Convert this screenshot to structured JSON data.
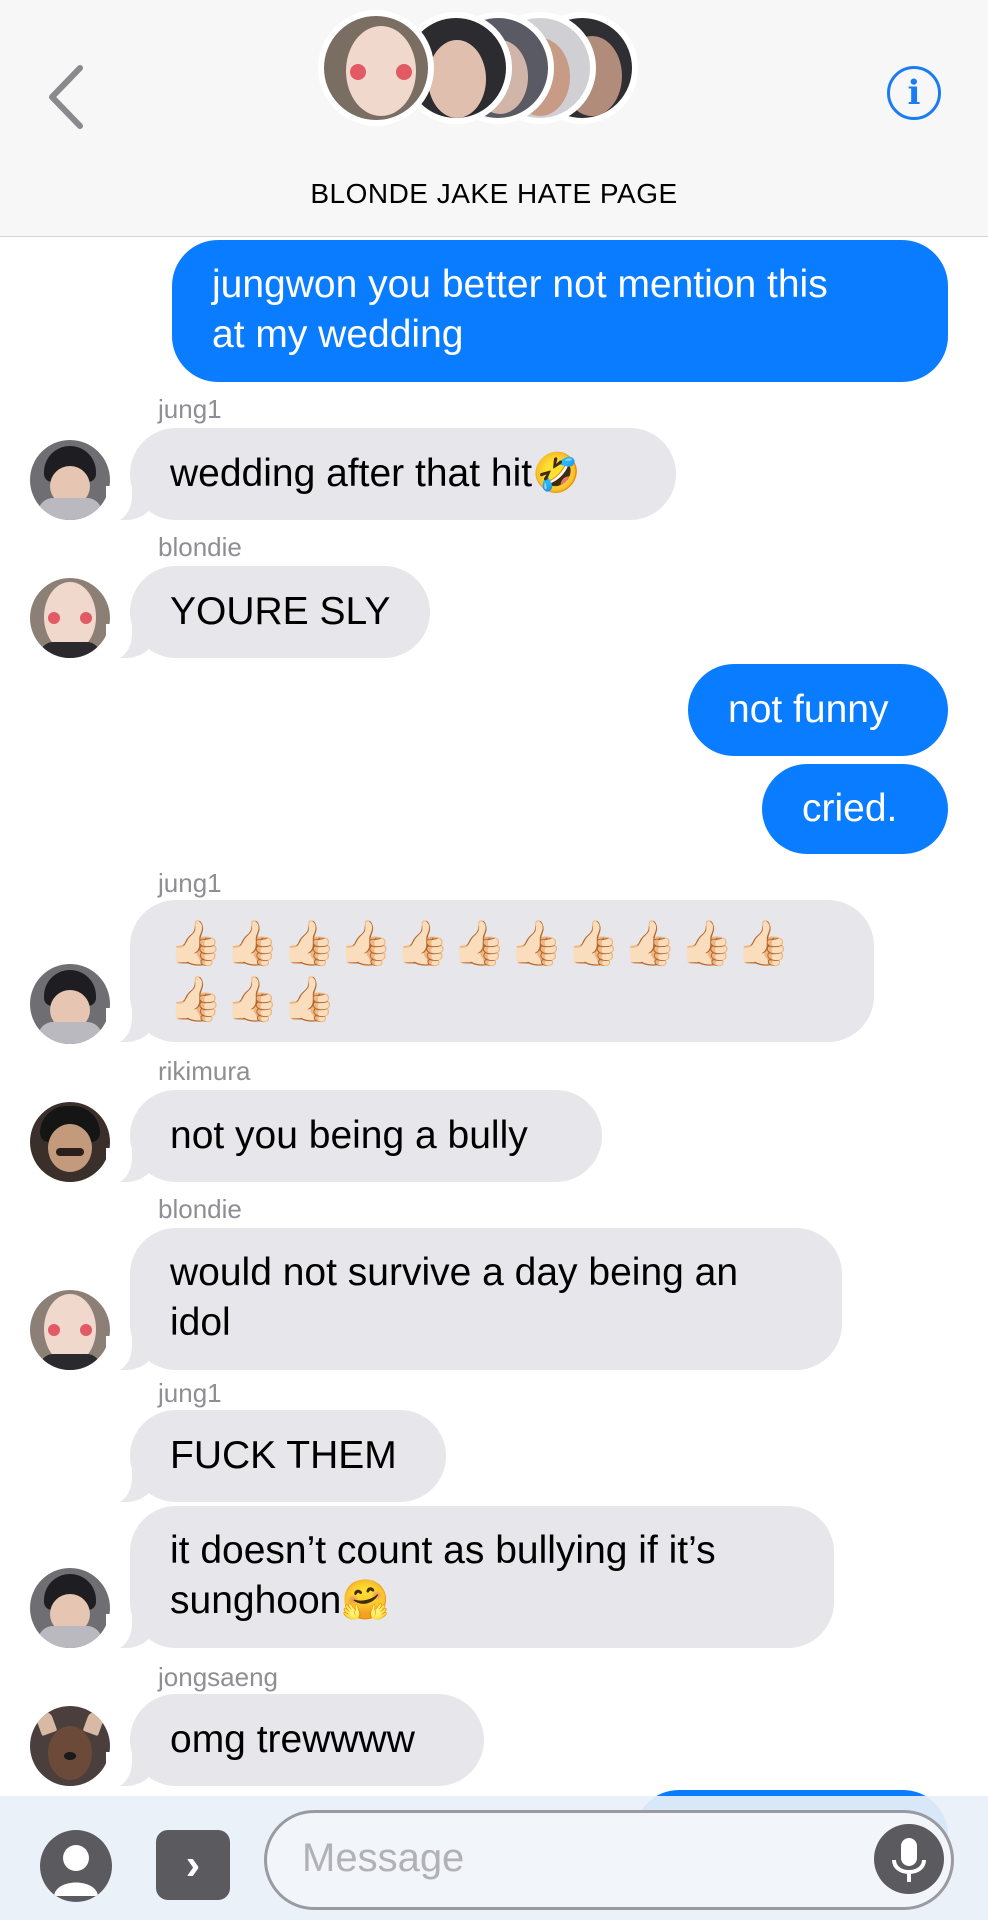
{
  "header": {
    "title": "BLONDE JAKE HATE PAGE",
    "back_icon": "chevron-left-icon",
    "info_icon": "info-icon",
    "info_glyph": "i",
    "accent_color": "#1b7cf2"
  },
  "messages": [
    {
      "text": "jungwon you better not mention this at my wedding",
      "line1": "jungwon you better not mention this",
      "line2": "at my wedding"
    },
    {
      "sender": "jung1",
      "text": "wedding after that hit",
      "emoji": "🤣"
    },
    {
      "sender": "blondie",
      "text": "YOURE SLY"
    },
    {
      "text": "not funny"
    },
    {
      "text": "cried."
    },
    {
      "sender": "jung1",
      "text": "👍🏻👍🏻👍🏻👍🏻👍🏻👍🏻👍🏻👍🏻👍🏻👍🏻👍🏻👍🏻👍🏻👍🏻"
    },
    {
      "sender": "rikimura",
      "text": "not you being a bully"
    },
    {
      "sender": "blondie",
      "line1": "would not survive a day being an",
      "line2": "idol"
    },
    {
      "sender": "jung1",
      "text": "FUCK THEM"
    },
    {
      "line1": "it doesn’t count as bullying if it’s",
      "line2": "sunghoon",
      "emoji": "🤗"
    },
    {
      "sender": "jongsaeng",
      "text": "omg trewwww"
    }
  ],
  "input": {
    "placeholder": "Message",
    "contact_icon": "person-silhouette-icon",
    "expand_icon": "chevron-right-icon",
    "expand_glyph": "›",
    "mic_icon": "microphone-icon"
  },
  "colors": {
    "outgoing_bubble": "#0a7cff",
    "incoming_bubble": "#e6e6eb",
    "sender_label": "#8e8e93"
  }
}
